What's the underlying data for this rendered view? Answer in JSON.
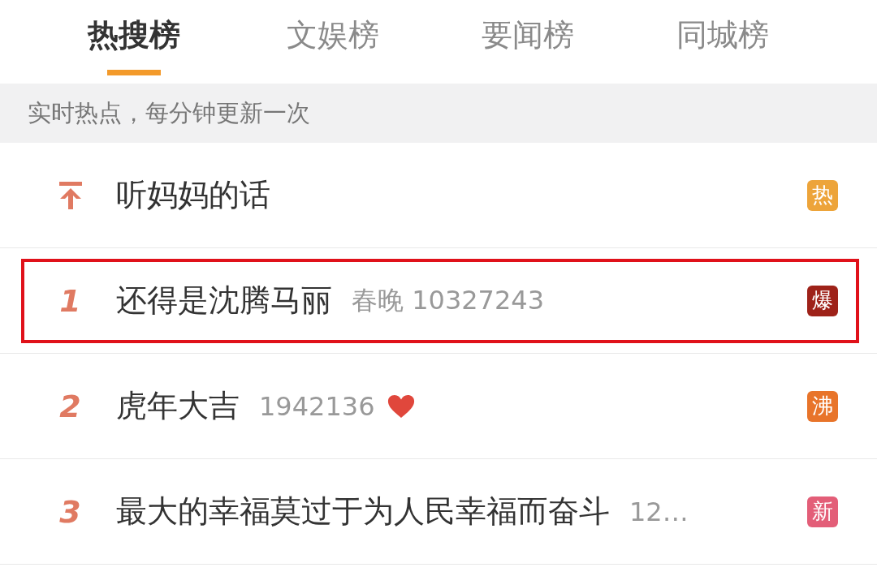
{
  "tabs": [
    {
      "label": "热搜榜",
      "selected": true
    },
    {
      "label": "文娱榜",
      "selected": false
    },
    {
      "label": "要闻榜",
      "selected": false
    },
    {
      "label": "同城榜",
      "selected": false
    }
  ],
  "notice": "实时热点，每分钟更新一次",
  "rows": [
    {
      "kind": "pinned",
      "title": "听妈妈的话",
      "badge": "热",
      "color": "#eda43a",
      "highlighted": false,
      "heart": false
    },
    {
      "kind": "ranked",
      "rank": "1",
      "title": "还得是沈腾马丽",
      "meta": "春晚 10327243",
      "badge": "爆",
      "color": "#9e2219",
      "highlighted": true,
      "heart": false
    },
    {
      "kind": "ranked",
      "rank": "2",
      "title": "虎年大吉",
      "meta": "1942136",
      "badge": "沸",
      "color": "#e8742a",
      "highlighted": false,
      "heart": true
    },
    {
      "kind": "ranked",
      "rank": "3",
      "title": "最大的幸福莫过于为人民幸福而奋斗",
      "meta": "12…",
      "badge": "新",
      "color": "#e35e78",
      "highlighted": false,
      "heart": false
    }
  ]
}
